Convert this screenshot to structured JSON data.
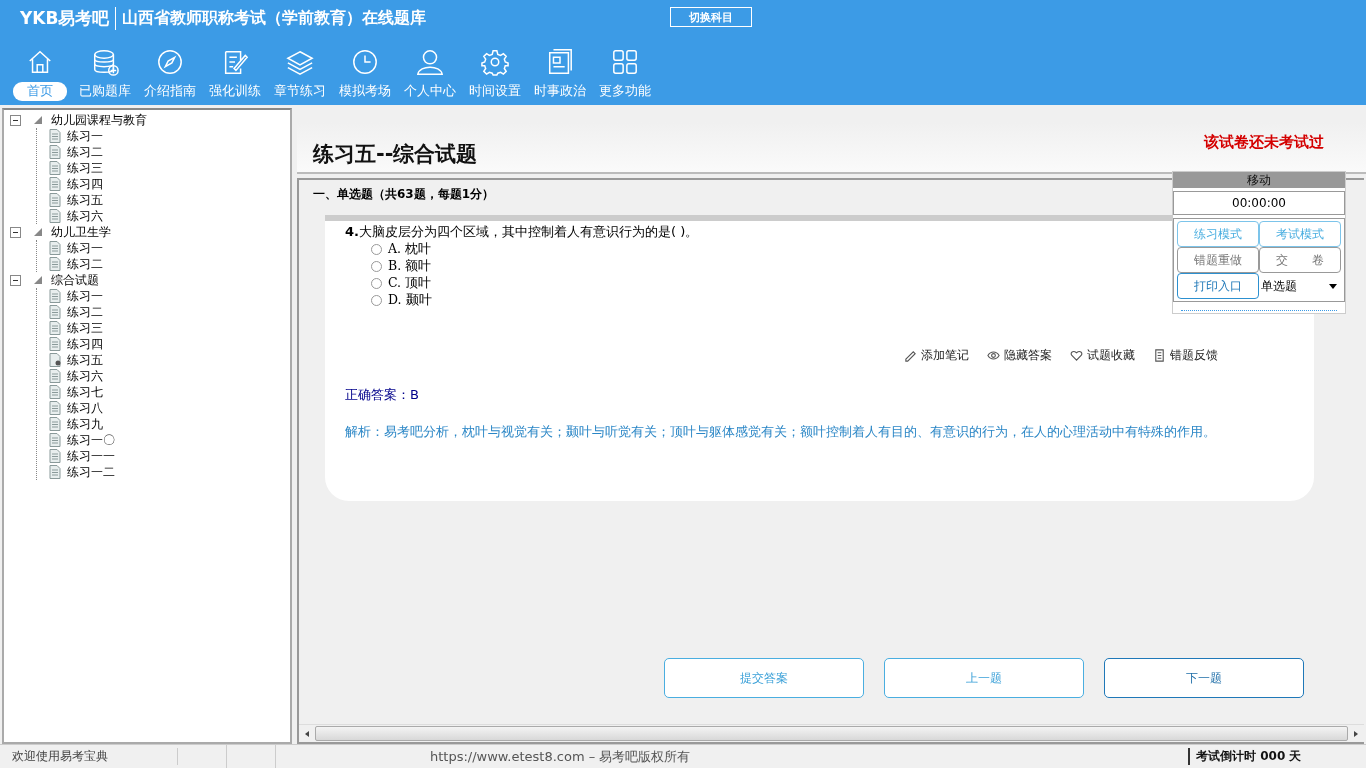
{
  "header": {
    "logo": "YKB易考吧",
    "title": "山西省教师职称考试（学前教育）在线题库",
    "switch_button": "切换科目"
  },
  "toolbar": [
    {
      "label": "首页",
      "selected": true,
      "kind": "home"
    },
    {
      "label": "已购题库",
      "selected": false,
      "kind": "database"
    },
    {
      "label": "介绍指南",
      "selected": false,
      "kind": "compass"
    },
    {
      "label": "强化训练",
      "selected": false,
      "kind": "edit"
    },
    {
      "label": "章节练习",
      "selected": false,
      "kind": "layers"
    },
    {
      "label": "模拟考场",
      "selected": false,
      "kind": "clock"
    },
    {
      "label": "个人中心",
      "selected": false,
      "kind": "user"
    },
    {
      "label": "时间设置",
      "selected": false,
      "kind": "gear"
    },
    {
      "label": "时事政治",
      "selected": false,
      "kind": "news"
    },
    {
      "label": "更多功能",
      "selected": false,
      "kind": "grid"
    }
  ],
  "tree": [
    {
      "label": "幼儿园课程与教育",
      "expanded": true,
      "children": [
        {
          "label": "练习一",
          "selected": false
        },
        {
          "label": "练习二",
          "selected": false
        },
        {
          "label": "练习三",
          "selected": false
        },
        {
          "label": "练习四",
          "selected": false
        },
        {
          "label": "练习五",
          "selected": false
        },
        {
          "label": "练习六",
          "selected": false
        }
      ]
    },
    {
      "label": "幼儿卫生学",
      "expanded": true,
      "children": [
        {
          "label": "练习一",
          "selected": false
        },
        {
          "label": "练习二",
          "selected": false
        }
      ]
    },
    {
      "label": "综合试题",
      "expanded": true,
      "children": [
        {
          "label": "练习一",
          "selected": false
        },
        {
          "label": "练习二",
          "selected": false
        },
        {
          "label": "练习三",
          "selected": false
        },
        {
          "label": "练习四",
          "selected": false
        },
        {
          "label": "练习五",
          "selected": true
        },
        {
          "label": "练习六",
          "selected": false
        },
        {
          "label": "练习七",
          "selected": false
        },
        {
          "label": "练习八",
          "selected": false
        },
        {
          "label": "练习九",
          "selected": false
        },
        {
          "label": "练习一〇",
          "selected": false
        },
        {
          "label": "练习一一",
          "selected": false
        },
        {
          "label": "练习一二",
          "selected": false
        }
      ]
    }
  ],
  "paper": {
    "title": "练习五--综合试题",
    "status": "该试卷还未考试过",
    "section": "一、单选题（共63题，每题1分）"
  },
  "question": {
    "number": "4.",
    "text": "大脑皮层分为四个区域，其中控制着人有意识行为的是(  )。",
    "options": [
      {
        "label": "A. 枕叶",
        "selected": false
      },
      {
        "label": "B. 额叶",
        "selected": false
      },
      {
        "label": "C. 顶叶",
        "selected": false
      },
      {
        "label": "D. 颞叶",
        "selected": false
      }
    ],
    "actions": [
      {
        "label": "添加笔记",
        "kind": "pen"
      },
      {
        "label": "隐藏答案",
        "kind": "eye"
      },
      {
        "label": "试题收藏",
        "kind": "heart"
      },
      {
        "label": "错题反馈",
        "kind": "doc"
      }
    ],
    "answer": "正确答案：B",
    "analysis": "解析：易考吧分析，枕叶与视觉有关；颞叶与听觉有关；顶叶与躯体感觉有关；额叶控制着人有目的、有意识的行为，在人的心理活动中有特殊的作用。"
  },
  "control_panel": {
    "move": "移动",
    "timer": "00:00:00",
    "buttons": [
      {
        "label": "练习模式",
        "kind": "mode"
      },
      {
        "label": "考试模式",
        "kind": "mode"
      },
      {
        "label": "错题重做",
        "kind": "plain"
      },
      {
        "label": "交　　卷",
        "kind": "plain"
      },
      {
        "label": "打印入口",
        "kind": "print"
      }
    ],
    "type_select": "单选题"
  },
  "nav_buttons": [
    "提交答案",
    "上一题",
    "下一题"
  ],
  "status_bar": {
    "welcome": "欢迎使用易考宝典",
    "copyright": "https://www.etest8.com – 易考吧版权所有",
    "countdown": "考试倒计时 000 天"
  }
}
